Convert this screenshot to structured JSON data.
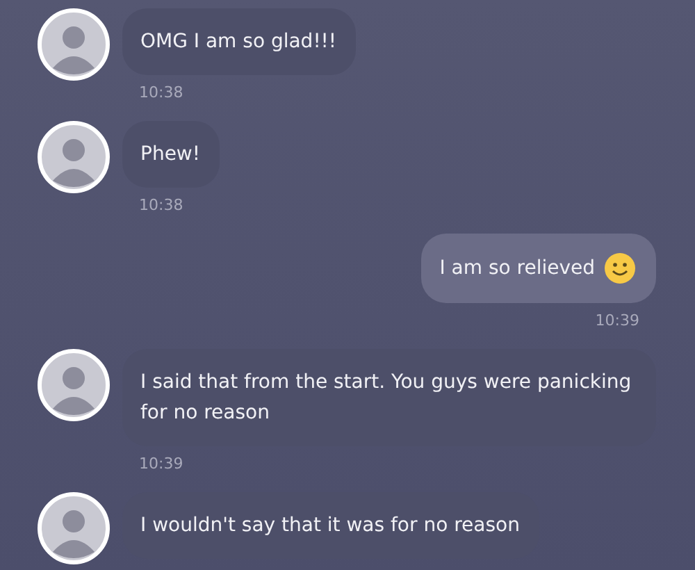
{
  "messages": [
    {
      "kind": "incoming",
      "text": "OMG I am so glad!!!",
      "time": "10:38"
    },
    {
      "kind": "incoming",
      "text": "Phew!",
      "time": "10:38"
    },
    {
      "kind": "outgoing",
      "text": "I am so relieved",
      "emoji": true,
      "time": "10:39"
    },
    {
      "kind": "incoming",
      "text": "I said that from the start. You guys were panicking for no reason",
      "time": "10:39"
    },
    {
      "kind": "incoming",
      "text": "I wouldn't say that it was for no reason"
    }
  ]
}
